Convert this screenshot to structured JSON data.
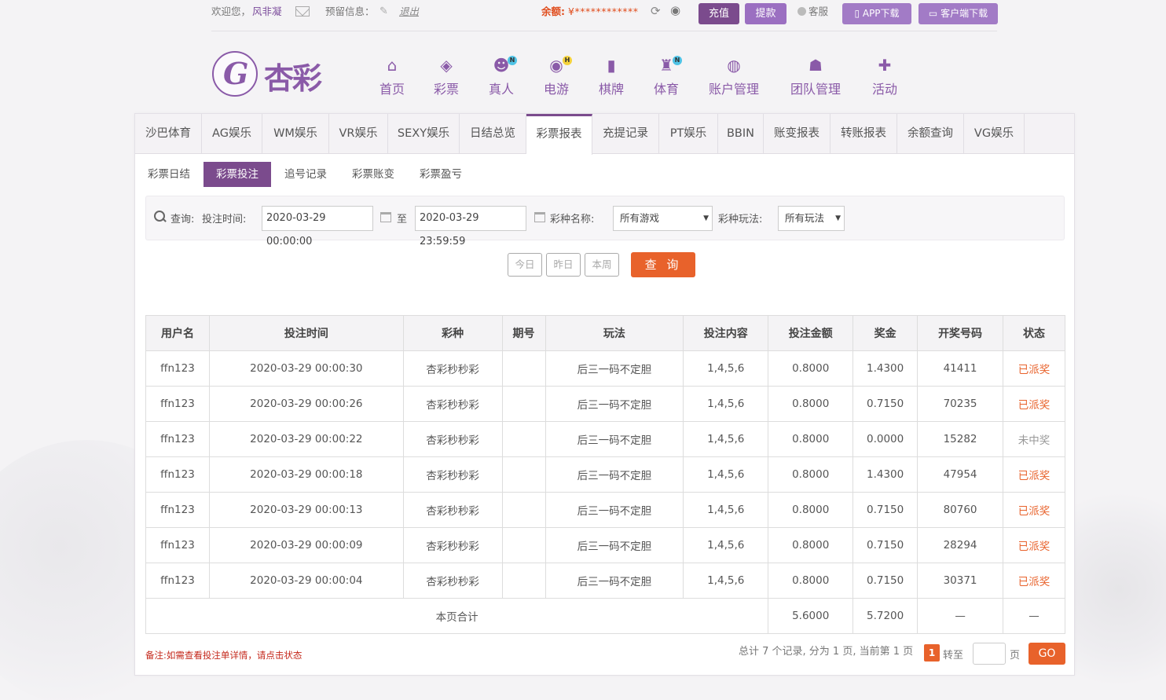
{
  "topbar": {
    "welcome": "欢迎您，",
    "username": "风非凝",
    "reserve_info": "预留信息：",
    "logout": "退出",
    "balance_label": "余额:",
    "balance_value": "¥************",
    "recharge": "充值",
    "withdraw": "提款",
    "service": "客服",
    "app_download": "APP下载",
    "client_download": "客户端下载"
  },
  "logo": {
    "text": "杏彩"
  },
  "nav": [
    {
      "label": "首页",
      "icon": "home-icon",
      "glyph": "⌂"
    },
    {
      "label": "彩票",
      "icon": "ticket-icon",
      "glyph": "◈"
    },
    {
      "label": "真人",
      "icon": "dealer-icon",
      "glyph": "☻",
      "badge": "N"
    },
    {
      "label": "电游",
      "icon": "gamepad-icon",
      "glyph": "◉",
      "badge": "H"
    },
    {
      "label": "棋牌",
      "icon": "cards-icon",
      "glyph": "▮"
    },
    {
      "label": "体育",
      "icon": "trophy-icon",
      "glyph": "♜",
      "badge": "N"
    },
    {
      "label": "账户管理",
      "icon": "account-icon",
      "glyph": "◍"
    },
    {
      "label": "团队管理",
      "icon": "team-icon",
      "glyph": "☗"
    },
    {
      "label": "活动",
      "icon": "gift-icon",
      "glyph": "✚"
    }
  ],
  "tabs": [
    "沙巴体育",
    "AG娱乐",
    "WM娱乐",
    "VR娱乐",
    "SEXY娱乐",
    "日结总览",
    "彩票报表",
    "充提记录",
    "PT娱乐",
    "BBIN",
    "账变报表",
    "转账报表",
    "余额查询",
    "VG娱乐"
  ],
  "active_tab": "彩票报表",
  "subtabs": [
    "彩票日结",
    "彩票投注",
    "追号记录",
    "彩票账变",
    "彩票盈亏"
  ],
  "active_subtab": "彩票投注",
  "filter": {
    "query_label": "查询:",
    "bet_time_label": "投注时间:",
    "start_time": "2020-03-29 00:00:00",
    "to_label": "至",
    "end_time": "2020-03-29 23:59:59",
    "lottery_name_label": "彩种名称:",
    "lottery_name_value": "所有游戏",
    "play_label": "彩种玩法:",
    "play_value": "所有玩法"
  },
  "quick": {
    "today": "今日",
    "yesterday": "昨日",
    "this_week": "本周",
    "query": "查 询"
  },
  "table": {
    "headers": [
      "用户名",
      "投注时间",
      "彩种",
      "期号",
      "玩法",
      "投注内容",
      "投注金额",
      "奖金",
      "开奖号码",
      "状态"
    ],
    "rows": [
      [
        "ffn123",
        "2020-03-29 00:00:30",
        "杏彩秒秒彩",
        "",
        "后三一码不定胆",
        "1,4,5,6",
        "0.8000",
        "1.4300",
        "41411",
        "已派奖"
      ],
      [
        "ffn123",
        "2020-03-29 00:00:26",
        "杏彩秒秒彩",
        "",
        "后三一码不定胆",
        "1,4,5,6",
        "0.8000",
        "0.7150",
        "70235",
        "已派奖"
      ],
      [
        "ffn123",
        "2020-03-29 00:00:22",
        "杏彩秒秒彩",
        "",
        "后三一码不定胆",
        "1,4,5,6",
        "0.8000",
        "0.0000",
        "15282",
        "未中奖"
      ],
      [
        "ffn123",
        "2020-03-29 00:00:18",
        "杏彩秒秒彩",
        "",
        "后三一码不定胆",
        "1,4,5,6",
        "0.8000",
        "1.4300",
        "47954",
        "已派奖"
      ],
      [
        "ffn123",
        "2020-03-29 00:00:13",
        "杏彩秒秒彩",
        "",
        "后三一码不定胆",
        "1,4,5,6",
        "0.8000",
        "0.7150",
        "80760",
        "已派奖"
      ],
      [
        "ffn123",
        "2020-03-29 00:00:09",
        "杏彩秒秒彩",
        "",
        "后三一码不定胆",
        "1,4,5,6",
        "0.8000",
        "0.7150",
        "28294",
        "已派奖"
      ],
      [
        "ffn123",
        "2020-03-29 00:00:04",
        "杏彩秒秒彩",
        "",
        "后三一码不定胆",
        "1,4,5,6",
        "0.8000",
        "0.7150",
        "30371",
        "已派奖"
      ]
    ],
    "total_label": "本页合计",
    "total_amount": "5.6000",
    "total_prize": "5.7200",
    "total_dash1": "—",
    "total_dash2": "—"
  },
  "footer": {
    "note": "备注:如需查看投注单详情，请点击状态",
    "summary": "总计 7 个记录, 分为 1 页, 当前第 1 页",
    "current_page": "1",
    "goto_label": "转至",
    "page_label": "页",
    "go": "GO"
  },
  "colors": {
    "brand": "#7b4b8d",
    "accent": "#e8622b",
    "paid": "#e8622b",
    "lose": "#999999"
  }
}
